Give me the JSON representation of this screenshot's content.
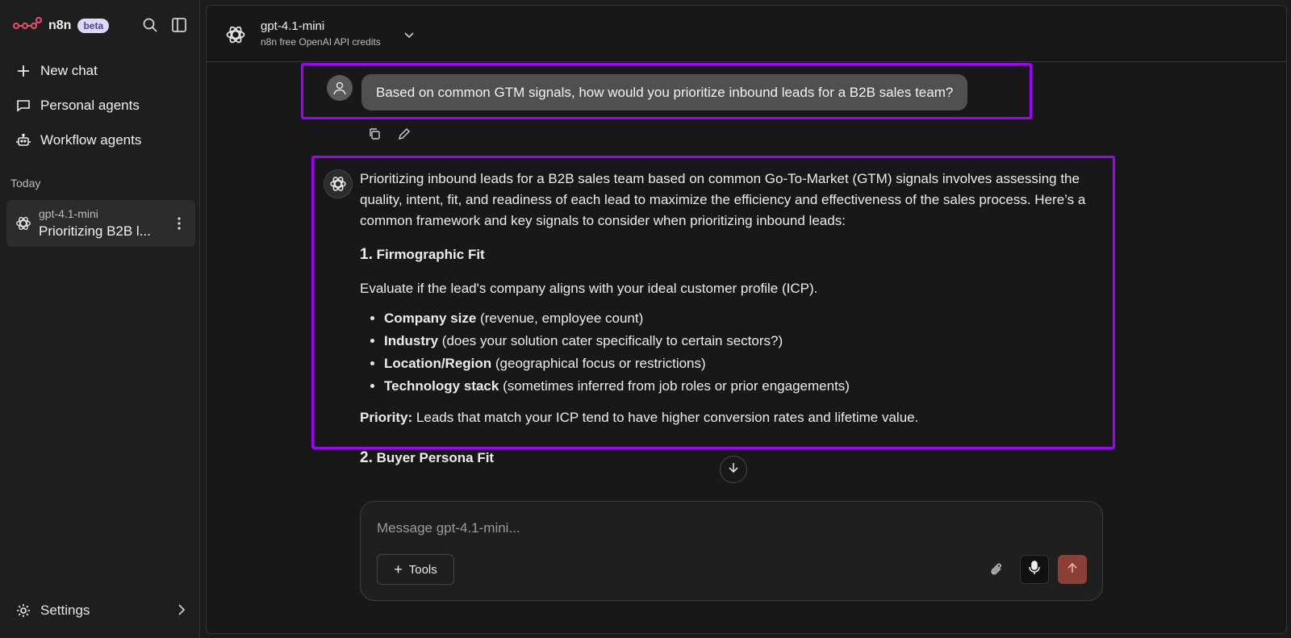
{
  "app": {
    "name": "n8n",
    "badge": "beta"
  },
  "sidebar": {
    "nav": [
      {
        "label": "New chat",
        "icon": "plus-icon"
      },
      {
        "label": "Personal agents",
        "icon": "chat-bubble-icon"
      },
      {
        "label": "Workflow agents",
        "icon": "robot-icon"
      }
    ],
    "section_today": "Today",
    "chats": [
      {
        "model": "gpt-4.1-mini",
        "title": "Prioritizing B2B l..."
      }
    ],
    "settings_label": "Settings"
  },
  "header": {
    "model_name": "gpt-4.1-mini",
    "model_sub": "n8n free OpenAI API credits"
  },
  "conversation": {
    "user_message": "Based on common GTM signals, how would you prioritize inbound leads for a B2B sales team?",
    "assistant": {
      "intro": "Prioritizing inbound leads for a B2B sales team based on common Go-To-Market (GTM) signals involves assessing the quality, intent, fit, and readiness of each lead to maximize the efficiency and effectiveness of the sales process. Here’s a common framework and key signals to consider when prioritizing inbound leads:",
      "section1_num": "1.",
      "section1_title": "Firmographic Fit",
      "section1_desc": "Evaluate if the lead's company aligns with your ideal customer profile (ICP).",
      "bullets": [
        {
          "bold": "Company size",
          "rest": " (revenue, employee count)"
        },
        {
          "bold": "Industry",
          "rest": " (does your solution cater specifically to certain sectors?)"
        },
        {
          "bold": "Location/Region",
          "rest": " (geographical focus or restrictions)"
        },
        {
          "bold": "Technology stack",
          "rest": " (sometimes inferred from job roles or prior engagements)"
        }
      ],
      "priority_label": "Priority:",
      "priority_text": " Leads that match your ICP tend to have higher conversion rates and lifetime value.",
      "section2_num": "2.",
      "section2_title": "Buyer Persona Fit"
    }
  },
  "composer": {
    "placeholder": "Message gpt-4.1-mini...",
    "tools_label": "Tools"
  },
  "colors": {
    "accent_highlight": "#a000ff",
    "send_button": "#8a3f37",
    "beta_badge_bg": "#ddd9f6"
  }
}
